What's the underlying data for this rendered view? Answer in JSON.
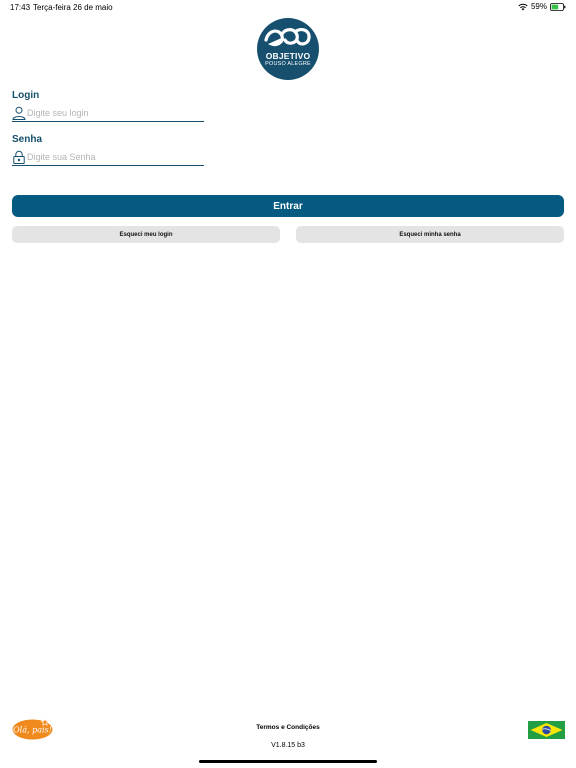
{
  "status_bar": {
    "time": "17:43",
    "date": "Terça-feira 26 de maio",
    "battery": "59%",
    "icons": [
      "wifi-icon",
      "battery-icon"
    ]
  },
  "logo": {
    "name": "OBJETIVO",
    "city": "POUSO ALEGRE",
    "color": "#17506e"
  },
  "login": {
    "label": "Login",
    "placeholder": "Digite seu login",
    "value": "",
    "icon": "user-icon"
  },
  "password": {
    "label": "Senha",
    "placeholder": "Digite sua Senha",
    "value": "",
    "icon": "lock-icon"
  },
  "actions": {
    "submit": "Entrar",
    "forgot_login": "Esqueci meu login",
    "forgot_password": "Esqueci minha senha"
  },
  "footer": {
    "badge_text": "Olá, pais!",
    "terms": "Termos e Condições",
    "version": "V1.8.15 b3",
    "flag": "brazil-flag-icon"
  },
  "colors": {
    "primary": "#055a81",
    "label": "#17506e",
    "secondary_button": "#e4e4e4",
    "badge": "#f08a1c"
  }
}
